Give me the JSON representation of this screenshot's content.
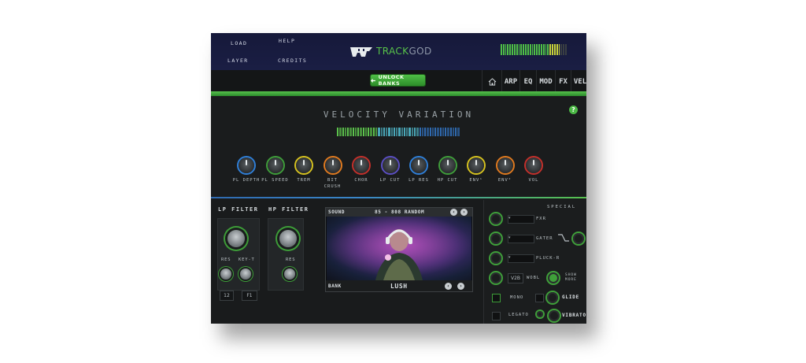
{
  "header": {
    "menu": {
      "load": "LOAD",
      "help": "HELP",
      "layer": "LAYER",
      "credits": "CREDITS"
    },
    "brand_track": "TRACK",
    "brand_god": "GOD"
  },
  "toolbar": {
    "unlock_label": "UNLOCK BANKS",
    "tabs": [
      "ARP",
      "EQ",
      "MOD",
      "FX",
      "VEL"
    ]
  },
  "velocity": {
    "title": "VELOCITY VARIATION",
    "help": "?"
  },
  "knobs": [
    {
      "label": "PL DEPTH",
      "color": "#2f7fd8"
    },
    {
      "label": "PL SPEED",
      "color": "#3f9e3a"
    },
    {
      "label": "TREM",
      "color": "#d6c21f"
    },
    {
      "label": "BIT CRUSH",
      "color": "#e07a1f"
    },
    {
      "label": "CHOR",
      "color": "#c4302b"
    },
    {
      "label": "LP CUT",
      "color": "#5b4fc4"
    },
    {
      "label": "LP RES",
      "color": "#2f7fd8"
    },
    {
      "label": "HP CUT",
      "color": "#3f9e3a"
    },
    {
      "label": "ENV¹",
      "color": "#d6c21f"
    },
    {
      "label": "ENV²",
      "color": "#e07a1f"
    },
    {
      "label": "VOL",
      "color": "#c4302b"
    }
  ],
  "filters": {
    "lp_title": "LP FILTER",
    "hp_title": "HP FILTER",
    "res": "RES",
    "key_t": "KEY-T",
    "hp_res": "RES",
    "box1": "12",
    "box2": "F1"
  },
  "sound": {
    "sound_label": "SOUND",
    "preset": "85 - 808 RANDOM",
    "bank_label": "BANK",
    "bank_name": "LUSH"
  },
  "special": {
    "title": "SPECIAL",
    "fx1": "FXR",
    "fx2": "GATER",
    "fx3": "PLUCK-R",
    "v2b": "V2B",
    "wobl": "WOBL",
    "show_more": "SHOW MORE",
    "mono": "MONO",
    "glide": "GLIDE",
    "legato": "LEGATO",
    "vibrato": "VIBRATO"
  }
}
